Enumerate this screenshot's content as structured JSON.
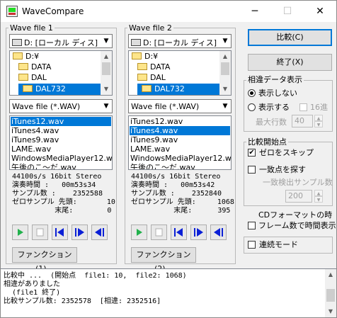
{
  "window": {
    "title": "WaveCompare",
    "minimize": "─",
    "maximize": "☐",
    "close": "✕"
  },
  "wave1": {
    "group_label": "Wave file 1",
    "drive": "D: [ローカル ディス]",
    "dirs": [
      "D:¥",
      "DATA",
      "DAL",
      "DAL732"
    ],
    "filter": "Wave file (*.WAV)",
    "files": [
      "iTunes12.wav",
      "iTunes4.wav",
      "iTunes9.wav",
      "LAME.wav",
      "WindowsMediaPlayer12.wav",
      "午後のこ～だ.wav"
    ],
    "selected_file_index": 0,
    "info": "44100s/s 16bit Stereo\n演奏時間 :   00m53s34\nサンプル数 :    2352588\nゼロサンプル 先頭:       10\n          末尾:        0",
    "function_button": "ファンクション(1)..."
  },
  "wave2": {
    "group_label": "Wave file 2",
    "drive": "D: [ローカル ディス]",
    "dirs": [
      "D:¥",
      "DATA",
      "DAL",
      "DAL732"
    ],
    "filter": "Wave file (*.WAV)",
    "files": [
      "iTunes12.wav",
      "iTunes4.wav",
      "iTunes9.wav",
      "LAME.wav",
      "WindowsMediaPlayer12.wav",
      "午後のこ～だ.wav"
    ],
    "selected_file_index": 1,
    "info": "44100s/s 16bit Stereo\n演奏時間 :   00m53s42\nサンプル数 :    2352840\nゼロサンプル 先頭:     1068\n          末尾:      395",
    "function_button": "ファンクション(2)..."
  },
  "buttons": {
    "compare": "比較(C)",
    "exit": "終了(X)"
  },
  "diff_display": {
    "label": "相違データ表示",
    "hide": "表示しない",
    "show": "表示する",
    "hex": "16進",
    "max_lines_label": "最大行数",
    "max_lines": "40"
  },
  "start_point": {
    "label": "比較開始点",
    "skip_zero": "ゼロをスキップ",
    "find_match": "一致点を探す",
    "match_samples_label": "一致検出サンプル数",
    "match_samples": "200"
  },
  "cd_format": {
    "label": "CDフォーマットの時",
    "frame_time": "フレーム数で時間表示"
  },
  "continuous_mode": "連続モード",
  "output_lines": [
    "比較中 ...  (開始点  file1: 10,  file2: 1068)",
    "相違がありました",
    "  (file1 終了)",
    "比較サンプル数: 2352578  [相違: 2352516]"
  ],
  "colors": {
    "selection": "#0078d7",
    "default_border": "#0078d7",
    "play_green": "#22b14c",
    "nav_blue": "#0a1fd6"
  }
}
